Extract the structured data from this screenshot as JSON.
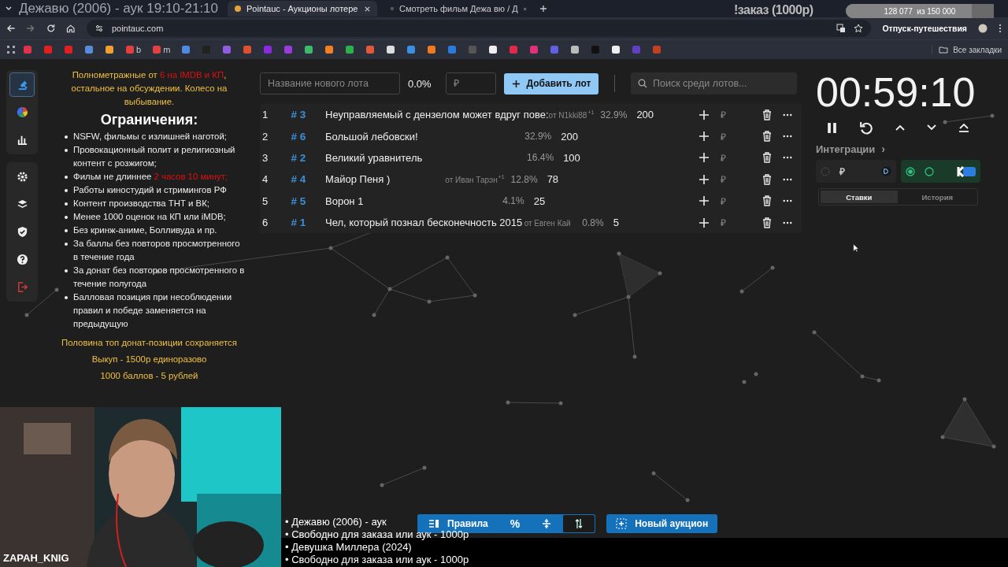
{
  "stream_overlay": {
    "title": "Дежавю (2006) - аук 19:10-21:10",
    "order_label": "!заказ (1000р)",
    "goal": {
      "reading": "128 077  из 150 000",
      "level": 0.85,
      "name": "Отпуск-путешествия"
    },
    "streamer": "ZAPAH_KNIG",
    "queue": [
      "• Дежавю (2006) - аук",
      "• Свободно для заказа или аук - 1000р",
      "• Девушка Миллера (2024)",
      "• Свободно для заказа или аук - 1000р"
    ]
  },
  "browser": {
    "tabs": [
      {
        "title": "Pointauc - Аукционы лотере",
        "selected": true
      },
      {
        "title": "Смотреть фильм Дежа вю / Д",
        "selected": false
      }
    ],
    "url": "pointauc.com",
    "bookmarks_bar": {
      "labels": [
        "b",
        "m"
      ],
      "all_bookmarks": "Все закладки"
    }
  },
  "sidebar": {
    "items": [
      {
        "selected": true
      },
      {
        "selected": false
      },
      {
        "selected": false
      },
      {
        "selected": false
      },
      {
        "selected": false
      },
      {
        "selected": false
      },
      {
        "selected": false
      },
      {
        "selected": false
      }
    ]
  },
  "rules": {
    "intro": [
      {
        "text": "Полнометражные от "
      },
      {
        "text": "6 на IMDB и КП",
        "highlight": true
      },
      {
        "text": ", остальное на обсуждении. Колесо на выбывание."
      }
    ],
    "heading": "Ограничения:",
    "items": [
      [
        {
          "text": "NSFW, фильмы с излишней наготой;"
        }
      ],
      [
        {
          "text": "Провокационный полит и религиозный контент с розжигом;"
        }
      ],
      [
        {
          "text": "Фильм не длиннее "
        },
        {
          "text": "2 часов 10 минут;",
          "highlight": true
        }
      ],
      [
        {
          "text": "Работы киностудий и стримингов РФ"
        }
      ],
      [
        {
          "text": "Контент производства ТНТ и ВК;"
        }
      ],
      [
        {
          "text": "Менее 1000 оценок на КП или iMDB;"
        }
      ],
      [
        {
          "text": "Без кринж-аниме, Болливуда и пр."
        }
      ],
      [
        {
          "text": "За баллы без повторов просмотренного в течение года"
        }
      ],
      [
        {
          "text": "За донат без повторов просмотренного в течение полугода"
        }
      ],
      [
        {
          "text": "Балловая позиция при несоблюдении правил и победе заменяется на предыдущую"
        }
      ]
    ],
    "notes": [
      "Половина топ донат-позиции сохраняется",
      "Выкуп - 1500р единоразово",
      "1000 баллов - 5 рублей"
    ]
  },
  "new_lot": {
    "name_placeholder": "Название нового лота",
    "percent": "0.0%",
    "amount_placeholder": "₽",
    "add_button": "Добавить лот",
    "search_placeholder": "Поиск среди лотов..."
  },
  "lots": [
    {
      "index": "1",
      "id": "# 3",
      "name": "Неуправляемый с дензелом может вдруг пове:",
      "author": "от N1kki88",
      "bonus": "+1",
      "percent": "32.9%",
      "amount": "200"
    },
    {
      "index": "2",
      "id": "# 6",
      "name": "Большой лебовски!",
      "percent": "32.9%",
      "amount": "200"
    },
    {
      "index": "3",
      "id": "# 2",
      "name": "Великий уравнитель",
      "percent": "16.4%",
      "amount": "100"
    },
    {
      "index": "4",
      "id": "# 4",
      "name": "Майор Пеня )",
      "author": "от Иван Тарэн",
      "bonus": "+1",
      "percent": "12.8%",
      "amount": "78"
    },
    {
      "index": "5",
      "id": "# 5",
      "name": "Ворон 1",
      "percent": "4.1%",
      "amount": "25"
    },
    {
      "index": "6",
      "id": "# 1",
      "name": "Чел, который познал бесконечность 2015",
      "author": "от Евген Кай",
      "percent": "0.8%",
      "amount": "5"
    }
  ],
  "lot_action_currency": "₽",
  "timer": {
    "time": "00:59:10"
  },
  "integrations": {
    "title": "Интеграции",
    "chevron": "›",
    "cards": [
      {
        "currency": "₽",
        "active": false
      },
      {
        "active": true
      }
    ]
  },
  "history_tabs": [
    {
      "label": "Ставки",
      "selected": true
    },
    {
      "label": "История",
      "selected": false
    }
  ],
  "bottom_toolbar": {
    "rules": "Правила",
    "percent": "%",
    "new_auction": "Новый аукцион"
  }
}
